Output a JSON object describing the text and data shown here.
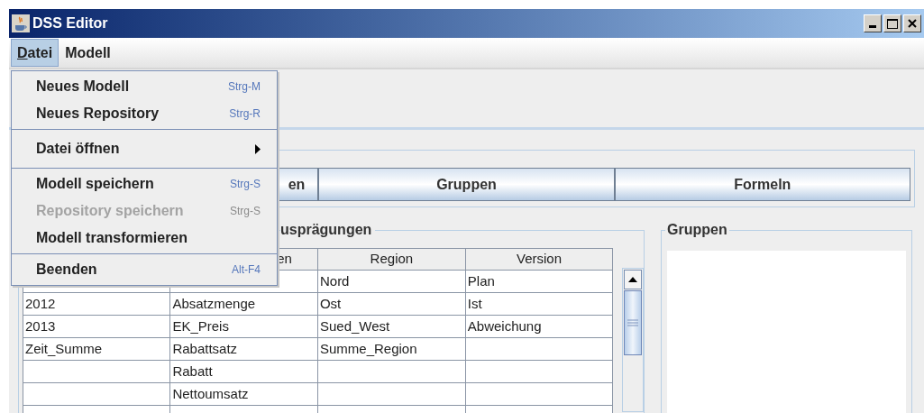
{
  "window": {
    "title": "DSS Editor"
  },
  "menu_bar": [
    {
      "label": "Datei",
      "selected": true,
      "mnemonic": true
    },
    {
      "label": "Modell",
      "selected": false,
      "mnemonic": false
    }
  ],
  "open_menu": {
    "groups": [
      [
        {
          "label": "Neues Modell",
          "shortcut": "Strg-M",
          "disabled": false
        },
        {
          "label": "Neues Repository",
          "shortcut": "Strg-R",
          "disabled": false
        }
      ],
      [
        {
          "label": "Datei öffnen",
          "submenu": true,
          "disabled": false
        }
      ],
      [
        {
          "label": "Modell speichern",
          "shortcut": "Strg-S",
          "disabled": false
        },
        {
          "label": "Repository speichern",
          "shortcut": "Strg-S",
          "disabled": true
        },
        {
          "label": "Modell transformieren",
          "disabled": false
        }
      ],
      [
        {
          "label": "Beenden",
          "shortcut": "Alt-F4",
          "disabled": false
        }
      ]
    ]
  },
  "buttons": [
    "en",
    "Gruppen",
    "Formeln"
  ],
  "left_panel": {
    "title": "usprägungen",
    "columns": [
      null,
      "en",
      "Region",
      "Version"
    ],
    "rows": [
      [
        null,
        null,
        "Nord",
        "Plan"
      ],
      [
        "2012",
        "Absatzmenge",
        "Ost",
        "Ist"
      ],
      [
        "2013",
        "EK_Preis",
        "Sued_West",
        "Abweichung"
      ],
      [
        "Zeit_Summe",
        "Rabattsatz",
        "Summe_Region",
        null
      ],
      [
        null,
        "Rabatt",
        null,
        null
      ],
      [
        null,
        "Nettoumsatz",
        null,
        null
      ]
    ]
  },
  "right_panel": {
    "title": "Gruppen"
  }
}
